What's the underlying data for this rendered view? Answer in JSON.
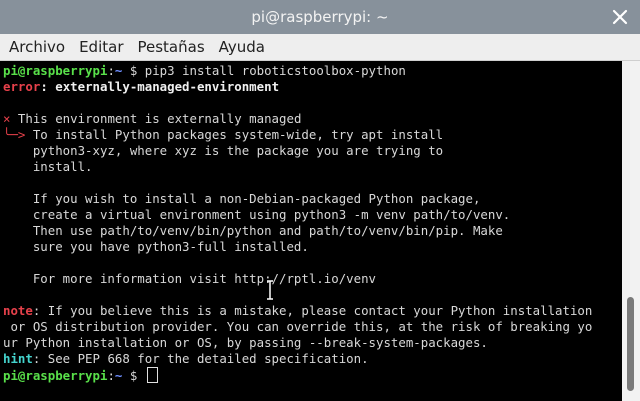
{
  "window": {
    "title": "pi@raspberrypi: ~",
    "close_icon": "close-icon"
  },
  "menubar": {
    "items": [
      "Archivo",
      "Editar",
      "Pestañas",
      "Ayuda"
    ]
  },
  "terminal": {
    "prompt_user": "pi@raspberrypi",
    "prompt_sep": ":",
    "prompt_dir": "~",
    "prompt_symbol": " $ ",
    "command": "pip3 install roboticstoolbox-python",
    "error_label": "error",
    "error_text": ": externally-managed-environment",
    "x_glyph": "×",
    "arrow_glyph": "╰─>",
    "env_msg": " This environment is externally managed",
    "body": [
      " To install Python packages system-wide, try apt install",
      "    python3-xyz, where xyz is the package you are trying to",
      "    install.",
      "",
      "    If you wish to install a non-Debian-packaged Python package,",
      "    create a virtual environment using python3 -m venv path/to/venv.",
      "    Then use path/to/venv/bin/python and path/to/venv/bin/pip. Make",
      "    sure you have python3-full installed.",
      "",
      "    For more information visit http://rptl.io/venv"
    ],
    "note_label": "note",
    "note_lines": [
      ": If you believe this is a mistake, please contact your Python installation",
      " or OS distribution provider. You can override this, at the risk of breaking yo",
      "ur Python installation or OS, by passing --break-system-packages."
    ],
    "hint_label": "hint",
    "hint_text": ": See PEP 668 for the detailed specification."
  },
  "colors": {
    "titlebar": "#87919b",
    "prompt_user": "#59e04a",
    "prompt_dir": "#6f8fff",
    "error": "#e7414b",
    "note": "#e7414b",
    "hint": "#44d4ce"
  }
}
